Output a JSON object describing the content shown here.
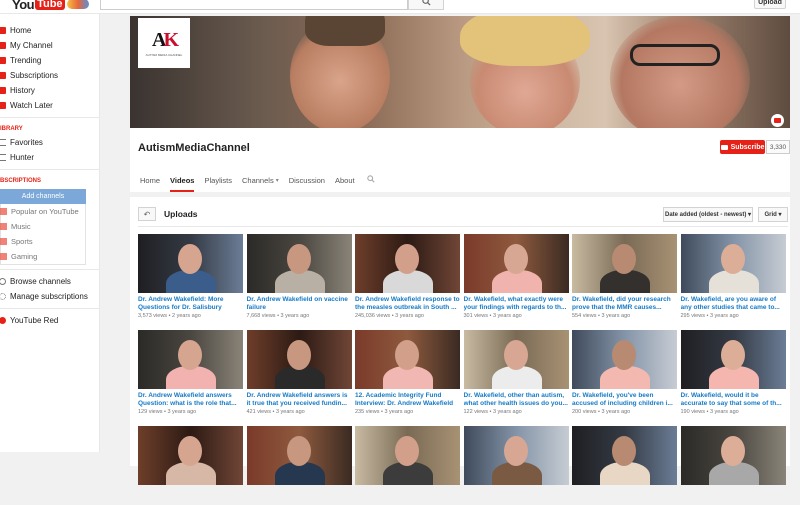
{
  "topbar": {
    "logo_text": "You",
    "logo_tube": "Tube",
    "search_icon": "search-icon",
    "upload_label": "Upload"
  },
  "sidebar": {
    "items": [
      {
        "label": "Home",
        "icon": "home-icon",
        "color": "#e62117"
      },
      {
        "label": "My Channel",
        "icon": "channel-icon",
        "color": "#e62117"
      },
      {
        "label": "Trending",
        "icon": "trending-icon",
        "color": "#e62117"
      },
      {
        "label": "Subscriptions",
        "icon": "subscriptions-icon",
        "color": "#e62117"
      },
      {
        "label": "History",
        "icon": "history-icon",
        "color": "#e62117"
      },
      {
        "label": "Watch Later",
        "icon": "watch-later-icon",
        "color": "#e62117"
      }
    ],
    "library_header": "IBRARY",
    "library": [
      {
        "label": "Favorites",
        "icon": "playlist-icon"
      },
      {
        "label": "Hunter",
        "icon": "playlist-icon"
      }
    ],
    "subs_header": "BSCRIPTIONS",
    "add_channels": "Add channels",
    "guide": [
      "Popular on YouTube",
      "Music",
      "Sports",
      "Gaming"
    ],
    "browse": "Browse channels",
    "manage": "Manage subscriptions",
    "red": "YouTube Red"
  },
  "banner": {
    "logo_text": "AMK",
    "logo_sub": "AUTISM MEDIA CHANNEL"
  },
  "channel": {
    "name": "AutismMediaChannel",
    "subscribe_label": "Subscribe",
    "subscriber_count": "3,330",
    "tabs": [
      "Home",
      "Videos",
      "Playlists",
      "Channels",
      "Discussion",
      "About"
    ],
    "active_tab": "Videos"
  },
  "uploads": {
    "title": "Uploads",
    "sort_label": "Date added (oldest - newest) ▾",
    "view_label": "Grid ▾",
    "back_icon": "back-arrow-icon"
  },
  "videos": [
    {
      "title": "Dr. Andrew Wakefield: More Questions for Dr. Salisbury",
      "views": "3,573 views",
      "age": "2 years ago"
    },
    {
      "title": "Dr. Andrew Wakefield on vaccine failure",
      "views": "7,668 views",
      "age": "3 years ago"
    },
    {
      "title": "Dr. Andrew Wakefield response to the measles outbreak in South ...",
      "views": "245,036 views",
      "age": "3 years ago"
    },
    {
      "title": "Dr. Wakefield, what exactly were your findings with regards to th...",
      "views": "301 views",
      "age": "3 years ago"
    },
    {
      "title": "Dr. Wakefield, did your research prove that the MMR causes...",
      "views": "554 views",
      "age": "3 years ago"
    },
    {
      "title": "Dr. Wakefield, are you aware of any other studies that came to...",
      "views": "295 views",
      "age": "3 years ago"
    },
    {
      "title": "Dr. Andrew Wakefield answers Question: what is the role that...",
      "views": "129 views",
      "age": "3 years ago"
    },
    {
      "title": "Dr. Andrew Wakefield answers is it true that you received fundin...",
      "views": "421 views",
      "age": "3 years ago"
    },
    {
      "title": "12. Academic Integrity Fund Interview: Dr. Andrew Wakefield",
      "views": "235 views",
      "age": "3 years ago"
    },
    {
      "title": "Dr. Wakefield, other than autism, what other health issues do you...",
      "views": "122 views",
      "age": "3 years ago"
    },
    {
      "title": "Dr. Wakefield, you've been accused of including children i...",
      "views": "200 views",
      "age": "3 years ago"
    },
    {
      "title": "Dr. Wakefield, would it be accurate to say that some of th...",
      "views": "190 views",
      "age": "3 years ago"
    },
    {
      "title": "",
      "views": "",
      "age": ""
    },
    {
      "title": "",
      "views": "",
      "age": ""
    },
    {
      "title": "",
      "views": "",
      "age": ""
    },
    {
      "title": "",
      "views": "",
      "age": ""
    },
    {
      "title": "",
      "views": "",
      "age": ""
    },
    {
      "title": "",
      "views": "",
      "age": ""
    }
  ]
}
